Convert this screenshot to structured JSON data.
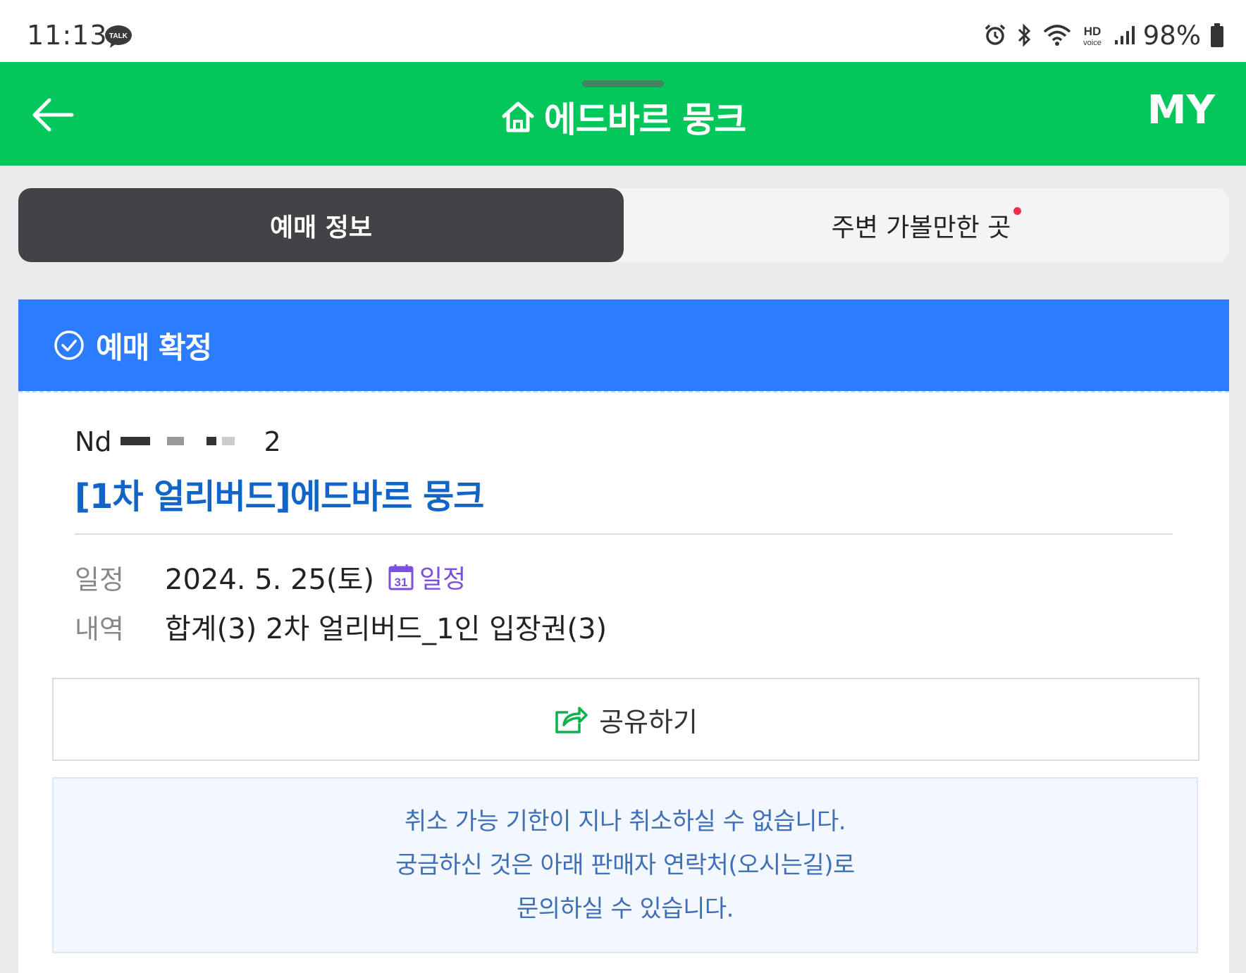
{
  "status_bar": {
    "time": "11:13",
    "talk_badge": "TALK",
    "hd_label": "HD",
    "voice_label": "voice",
    "battery": "98%",
    "icons": [
      "alarm-icon",
      "bluetooth-icon",
      "wifi-icon",
      "hd-voice-icon",
      "signal-icon",
      "battery-icon"
    ]
  },
  "header": {
    "title": "에드바르 뭉크",
    "my_label": "MY",
    "brand_color": "#03c75a"
  },
  "tabs": [
    {
      "label": "예매 정보",
      "active": true
    },
    {
      "label": "주변 가볼만한 곳",
      "active": false,
      "has_new_dot": true
    }
  ],
  "banner": {
    "status": "예매 확정",
    "color": "#2b7cff"
  },
  "booking": {
    "number_prefix": "Nd",
    "number_suffix": "2",
    "product_title": "[1차 얼리버드]에드바르 뭉크",
    "schedule_label": "일정",
    "schedule_value": "2024. 5. 25(토)",
    "calendar_link": "일정",
    "calendar_day": "31",
    "detail_label": "내역",
    "detail_value": "합계(3) 2차 얼리버드_1인 입장권(3)"
  },
  "share": {
    "label": "공유하기"
  },
  "notice": {
    "lines": [
      "취소 가능 기한이 지나 취소하실 수 없습니다.",
      "궁금하신 것은 아래 판매자 연락처(오시는길)로",
      "문의하실 수 있습니다."
    ]
  }
}
